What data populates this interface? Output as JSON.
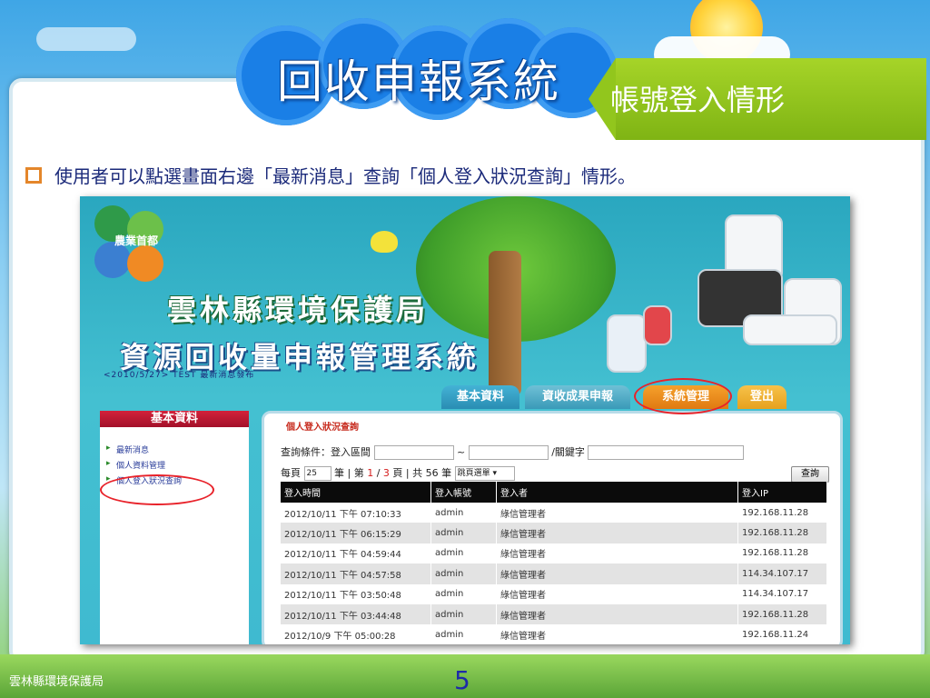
{
  "slide": {
    "title": "回收申報系統",
    "tag": "帳號登入情形",
    "bullet_text": "使用者可以點選畫面右邊「最新消息」查詢「個人登入狀況查詢」情形。",
    "footer_org": "雲林縣環境保護局",
    "page_number": "5"
  },
  "app": {
    "logo_text": "農業首都",
    "header_line1": "雲林縣環境保護局",
    "header_line2": "資源回收量申報管理系統",
    "ticker": "<2010/5/27> TEST 最新消息發布",
    "tabs": [
      {
        "label": "基本資料"
      },
      {
        "label": "資收成果申報"
      },
      {
        "label": "系統管理"
      },
      {
        "label": "登出"
      }
    ],
    "sidebar": {
      "header": "基本資料",
      "items": [
        {
          "label": "最新消息"
        },
        {
          "label": "個人資料管理"
        },
        {
          "label": "個人登入狀況查詢"
        }
      ]
    },
    "panel": {
      "title": "個人登入狀況查詢",
      "query_label": "查詢條件：登入區間",
      "range_sep": "~",
      "keyword_label": "/關鍵字",
      "per_page_prefix": "每頁",
      "per_page_value": "25",
      "per_page_suffix": "筆 | 第",
      "page_current": "1",
      "page_sep": "/",
      "page_total": "3",
      "page_suffix": "頁 | 共 56 筆",
      "jump_label": "跳頁選單",
      "search_button": "查詢",
      "columns": [
        "登入時間",
        "登入帳號",
        "登入者",
        "登入IP"
      ],
      "rows": [
        [
          "2012/10/11 下午 07:10:33",
          "admin",
          "綠信管理者",
          "192.168.11.28"
        ],
        [
          "2012/10/11 下午 06:15:29",
          "admin",
          "綠信管理者",
          "192.168.11.28"
        ],
        [
          "2012/10/11 下午 04:59:44",
          "admin",
          "綠信管理者",
          "192.168.11.28"
        ],
        [
          "2012/10/11 下午 04:57:58",
          "admin",
          "綠信管理者",
          "114.34.107.17"
        ],
        [
          "2012/10/11 下午 03:50:48",
          "admin",
          "綠信管理者",
          "114.34.107.17"
        ],
        [
          "2012/10/11 下午 03:44:48",
          "admin",
          "綠信管理者",
          "192.168.11.28"
        ],
        [
          "2012/10/9 下午 05:00:28",
          "admin",
          "綠信管理者",
          "192.168.11.24"
        ]
      ]
    }
  },
  "colors": {
    "title_gear": "#1a7fe6",
    "tag_green": "#92c61d",
    "bullet_text": "#1b2a7a",
    "highlight_ring": "#e8222a",
    "page_number": "#1e2ba8"
  }
}
